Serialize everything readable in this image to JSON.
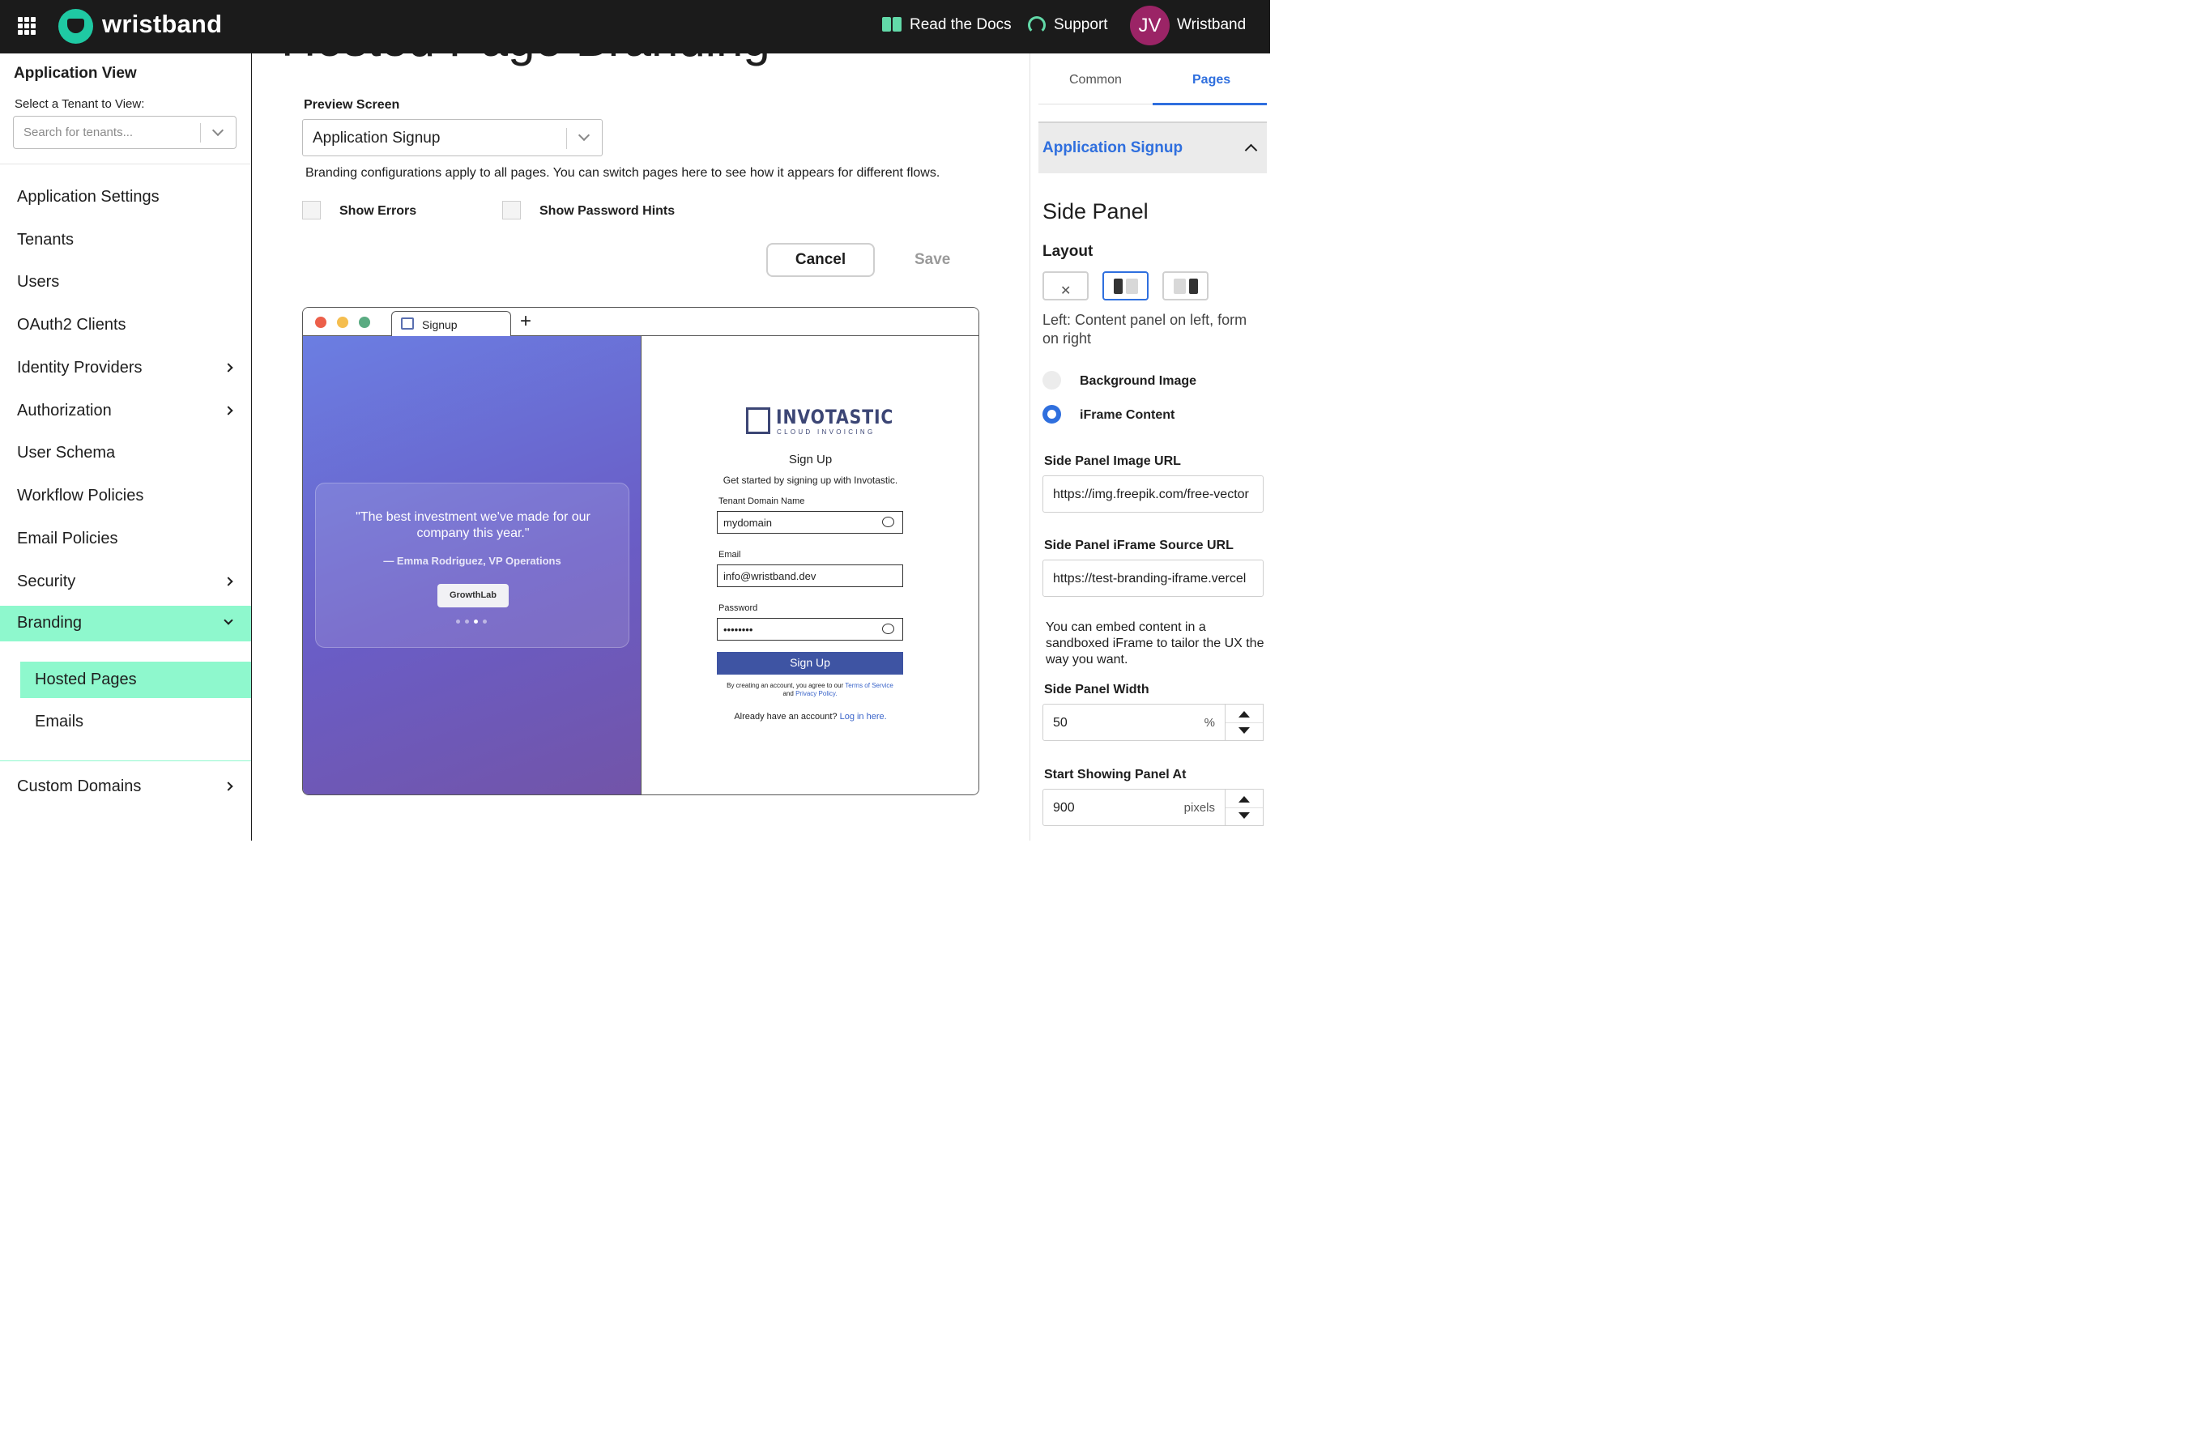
{
  "topbar": {
    "brand": "wristband",
    "docs_label": "Read the Docs",
    "support_label": "Support",
    "avatar_initials": "JV",
    "user_name": "Wristband",
    "accent": "#1fc9a3"
  },
  "sidebar": {
    "title": "Application View",
    "tenant_prompt": "Select a Tenant to View:",
    "tenant_placeholder": "Search for tenants...",
    "items": [
      {
        "label": "Application Settings"
      },
      {
        "label": "Tenants"
      },
      {
        "label": "Users"
      },
      {
        "label": "OAuth2 Clients"
      },
      {
        "label": "Identity Providers"
      },
      {
        "label": "Authorization"
      },
      {
        "label": "User Schema"
      },
      {
        "label": "Workflow Policies"
      },
      {
        "label": "Email Policies"
      },
      {
        "label": "Security"
      },
      {
        "label": "Branding"
      },
      {
        "label": "Custom Domains"
      }
    ],
    "branding_sub": [
      {
        "label": "Hosted Pages"
      },
      {
        "label": "Emails"
      }
    ],
    "active_color": "#8ef8cd"
  },
  "main": {
    "title": "Hosted Page Branding",
    "preview_label": "Preview Screen",
    "preview_value": "Application Signup",
    "helper": "Branding configurations apply to all pages. You can switch pages here to see how it appears for different flows.",
    "show_errors": "Show Errors",
    "show_password_hints": "Show Password Hints",
    "cancel": "Cancel",
    "save": "Save"
  },
  "preview": {
    "tab_label": "Signup",
    "plus": "+",
    "quote": "\"The best investment we've made for our company this year.\"",
    "author": "— Emma Rodriguez, VP Operations",
    "company": "GrowthLab",
    "logo_name": "INVOTASTIC",
    "logo_tag": "CLOUD INVOICING",
    "form_title": "Sign Up",
    "form_sub": "Get started by signing up with Invotastic.",
    "tenant_label": "Tenant Domain Name",
    "tenant_value": "mydomain",
    "email_label": "Email",
    "email_value": "info@wristband.dev",
    "password_label": "Password",
    "password_value": "••••••••",
    "submit": "Sign Up",
    "terms_prefix": "By creating an account, you agree to our",
    "terms_link": "Terms of Service",
    "terms_and": "and",
    "privacy_link": "Privacy Policy.",
    "login_prefix": "Already have an account?",
    "login_link": "Log in here."
  },
  "rpanel": {
    "tab_common": "Common",
    "tab_pages": "Pages",
    "accordion_title": "Application Signup",
    "section_title": "Side Panel",
    "layout_label": "Layout",
    "layout_desc": "Left: Content panel on left, form on right",
    "radio_bg": "Background Image",
    "radio_iframe": "iFrame Content",
    "image_url_label": "Side Panel Image URL",
    "image_url_value": "https://img.freepik.com/free-vector",
    "iframe_url_label": "Side Panel iFrame Source URL",
    "iframe_url_value": "https://test-branding-iframe.vercel",
    "iframe_note": "You can embed content in a sandboxed iFrame to tailor the UX the way you want.",
    "width_label": "Side Panel Width",
    "width_value": "50",
    "width_unit": "%",
    "start_label": "Start Showing Panel At",
    "start_value": "900",
    "start_unit": "pixels",
    "accent": "#2f6fde"
  }
}
